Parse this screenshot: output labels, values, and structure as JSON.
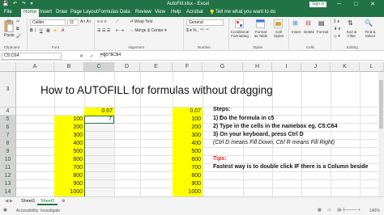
{
  "window": {
    "title": "AutoFill.xlsx - Excel",
    "sign_in": "Sign in",
    "quick_access": "💾 ↶ ↷ ▾",
    "controls": "─ □ ✕"
  },
  "tabs": [
    "File",
    "Home",
    "Insert",
    "Draw",
    "Page Layout",
    "Formulas",
    "Data",
    "Review",
    "View",
    "Help",
    "Acrobat"
  ],
  "tell_me": "Tell me what you want to do",
  "ribbon": {
    "paste_label": "Paste",
    "font_name": "Calibri",
    "font_size": "11",
    "wrap_text": "Wrap Text",
    "merge_center": "Merge & Center",
    "number_format": "General",
    "conditional_formatting": "Conditional Formatting",
    "format_as_table": "Format as Table",
    "cell_styles": "Cell Styles",
    "insert": "Insert",
    "delete": "Delete",
    "format": "Format",
    "sort_filter": "Sort & Filter",
    "find_select": "Find & Select",
    "groups": [
      "Clipboard",
      "Font",
      "Alignment",
      "Number",
      "Styles",
      "Cells",
      "Editing"
    ]
  },
  "formula_bar": {
    "name_box": "C5:C64",
    "formula": "=B5*$C$4"
  },
  "columns": [
    "A",
    "B",
    "C",
    "D",
    "E",
    "F",
    "G",
    "H",
    "I",
    "J",
    "K",
    "L"
  ],
  "rows": [
    "3",
    "4",
    "5",
    "6",
    "7",
    "8",
    "9",
    "10",
    "11",
    "12",
    "13",
    "14"
  ],
  "sheet": {
    "heading": "How to AUTOFILL for formulas without dragging",
    "c4": "0.07",
    "f4": "0.07",
    "c5": "7",
    "g5": "7",
    "b_values": [
      "100",
      "200",
      "300",
      "400",
      "500",
      "600",
      "700",
      "800",
      "900",
      "1000"
    ],
    "f_values": [
      "100",
      "200",
      "300",
      "400",
      "500",
      "600",
      "700",
      "800",
      "900",
      "1000"
    ],
    "steps_title": "Steps:",
    "step1": "1) Do the formula in c5",
    "step2": "2) Type in the cells in the namebox eg. C5:C64",
    "step3": "3) On your keyboard, press Ctrl D",
    "note": "(Ctrl D means Fill Down, Ctrl R means Fill Right)",
    "tips_title": "Tips:",
    "tip": "Fastest way is to double click IF there is a Column beside"
  },
  "sheet_tabs": [
    "Sheet1",
    "Sheet2"
  ],
  "status": {
    "accessibility": "Accessibility: Investigate",
    "zoom": "140%"
  }
}
